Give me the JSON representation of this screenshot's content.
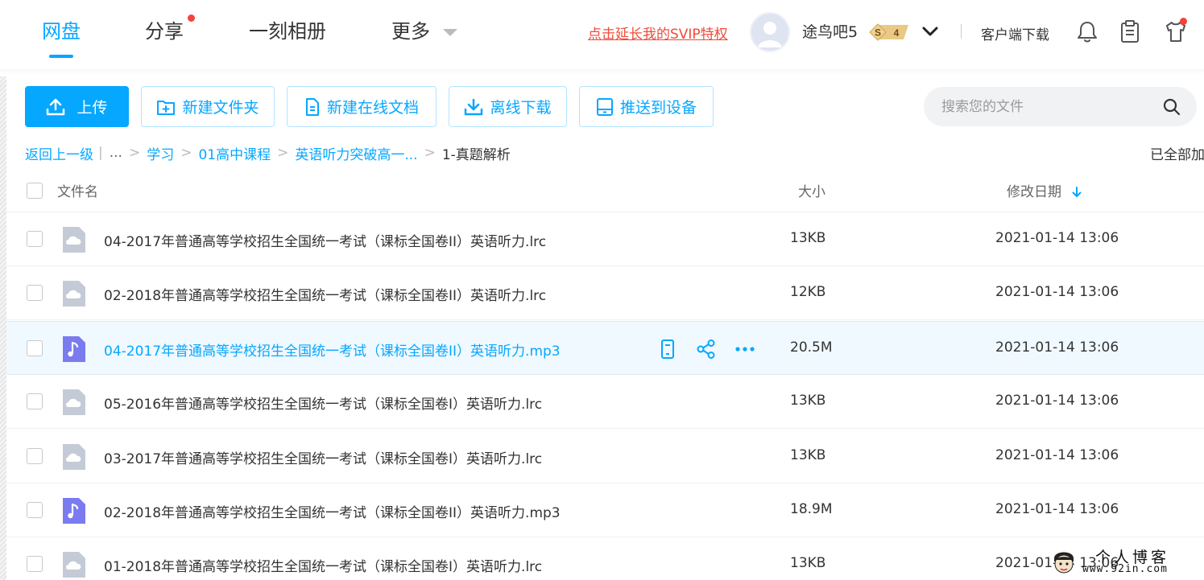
{
  "topnav": {
    "tabs": [
      {
        "label": "网盘",
        "active": true
      },
      {
        "label": "分享",
        "has_dot": true
      },
      {
        "label": "一刻相册"
      },
      {
        "label": "更多"
      }
    ],
    "svip_link": "点击延长我的SVIP特权",
    "username": "途鸟吧5",
    "vip_badge": {
      "symbol": "S",
      "level": "4"
    },
    "client_download": "客户端下载",
    "icons": [
      "bell-icon",
      "clipboard-icon",
      "tshirt-icon"
    ]
  },
  "toolbar": {
    "upload": "上传",
    "new_folder": "新建文件夹",
    "new_online_doc": "新建在线文档",
    "offline_download": "离线下载",
    "push_to_device": "推送到设备",
    "search_placeholder": "搜索您的文件"
  },
  "breadcrumb": {
    "back": "返回上一级",
    "ellipsis": "...",
    "items": [
      "学习",
      "01高中课程",
      "英语听力突破高一..."
    ],
    "current": "1-真题解析",
    "loaded_status": "已全部加"
  },
  "table": {
    "columns": {
      "name": "文件名",
      "size": "大小",
      "date": "修改日期"
    },
    "sort": {
      "column": "date",
      "direction": "desc"
    },
    "rows": [
      {
        "name": "04-2017年普通高等学校招生全国统一考试（课标全国卷II）英语听力.lrc",
        "size": "13KB",
        "date": "2021-01-14 13:06",
        "type": "lrc"
      },
      {
        "name": "02-2018年普通高等学校招生全国统一考试（课标全国卷II）英语听力.lrc",
        "size": "12KB",
        "date": "2021-01-14 13:06",
        "type": "lrc"
      },
      {
        "name": "04-2017年普通高等学校招生全国统一考试（课标全国卷II）英语听力.mp3",
        "size": "20.5M",
        "date": "2021-01-14 13:06",
        "type": "mp3",
        "hover": true
      },
      {
        "name": "05-2016年普通高等学校招生全国统一考试（课标全国卷I）英语听力.lrc",
        "size": "13KB",
        "date": "2021-01-14 13:06",
        "type": "lrc"
      },
      {
        "name": "03-2017年普通高等学校招生全国统一考试（课标全国卷I）英语听力.lrc",
        "size": "13KB",
        "date": "2021-01-14 13:06",
        "type": "lrc"
      },
      {
        "name": "02-2018年普通高等学校招生全国统一考试（课标全国卷II）英语听力.mp3",
        "size": "18.9M",
        "date": "2021-01-14 13:06",
        "type": "mp3"
      },
      {
        "name": "01-2018年普通高等学校招生全国统一考试（课标全国卷I）英语听力.lrc",
        "size": "13KB",
        "date": "2021-01-14 13:06",
        "type": "lrc"
      }
    ],
    "row_actions": [
      "phone-icon",
      "share-icon",
      "more-icon"
    ]
  },
  "watermark": {
    "title": "个人博客",
    "url": "www.92in.com"
  },
  "colors": {
    "accent": "#06a7ff",
    "danger": "#f04a38",
    "hover_row": "#f0f9ff",
    "audio_icon": "#7b7bf0",
    "lrc_icon": "#c4cbd6"
  }
}
